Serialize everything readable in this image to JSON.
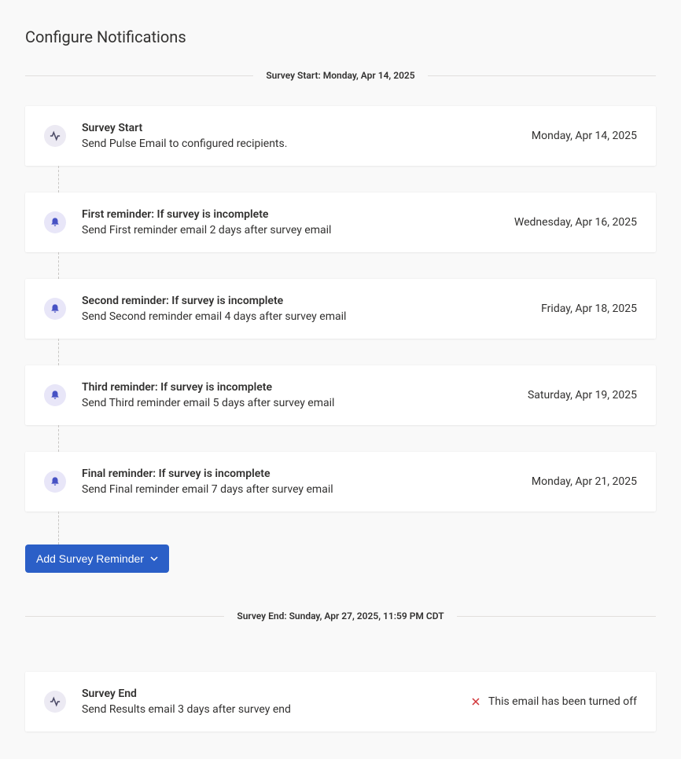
{
  "page": {
    "title": "Configure Notifications"
  },
  "startDivider": {
    "label": "Survey Start: Monday, Apr 14, 2025"
  },
  "timeline": [
    {
      "icon": "pulse",
      "title": "Survey Start",
      "desc": "Send Pulse Email to configured recipients.",
      "date": "Monday, Apr 14, 2025"
    },
    {
      "icon": "bell",
      "title": "First reminder: If survey is incomplete",
      "desc": "Send First reminder email 2 days after survey email",
      "date": "Wednesday, Apr 16, 2025"
    },
    {
      "icon": "bell",
      "title": "Second reminder: If survey is incomplete",
      "desc": "Send Second reminder email 4 days after survey email",
      "date": "Friday, Apr 18, 2025"
    },
    {
      "icon": "bell",
      "title": "Third reminder: If survey is incomplete",
      "desc": "Send Third reminder email 5 days after survey email",
      "date": "Saturday, Apr 19, 2025"
    },
    {
      "icon": "bell",
      "title": "Final reminder: If survey is incomplete",
      "desc": "Send Final reminder email 7 days after survey email",
      "date": "Monday, Apr 21, 2025"
    }
  ],
  "addButton": {
    "label": "Add Survey Reminder"
  },
  "endDivider": {
    "label": "Survey End: Sunday, Apr 27, 2025, 11:59 PM CDT"
  },
  "endCard": {
    "title": "Survey End",
    "desc": "Send Results email 3 days after survey end",
    "status": "This email has been turned off"
  }
}
